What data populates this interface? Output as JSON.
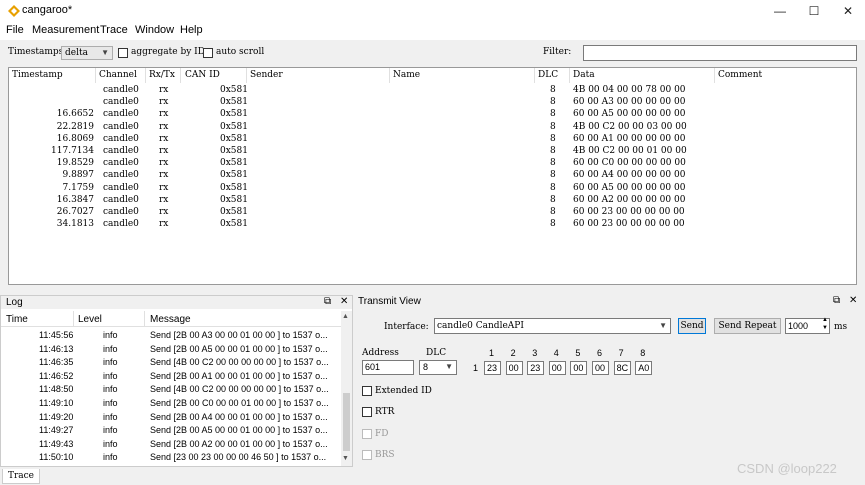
{
  "window": {
    "title": "cangaroo*",
    "minimize": "—",
    "maximize": "☐",
    "close": "✕"
  },
  "menu": [
    "File",
    "Measurement",
    "Trace",
    "Window",
    "Help"
  ],
  "toolbar": {
    "timestamps_label": "Timestamps:",
    "timestamps_value": "delta",
    "aggregate_label": "aggregate by ID",
    "autoscroll_label": "auto scroll",
    "filter_label": "Filter:",
    "filter_value": ""
  },
  "trace": {
    "columns": [
      "Timestamp",
      "Channel",
      "Rx/Tx",
      "CAN ID",
      "Sender",
      "Name",
      "DLC",
      "Data",
      "Comment"
    ],
    "rows": [
      {
        "ts": "",
        "ch": "candle0",
        "dir": "rx",
        "id": "0x581",
        "dlc": "8",
        "data": "4B 00 04 00 00 78 00 00"
      },
      {
        "ts": "",
        "ch": "candle0",
        "dir": "rx",
        "id": "0x581",
        "dlc": "8",
        "data": "60 00 A3 00 00 00 00 00"
      },
      {
        "ts": "16.6652",
        "ch": "candle0",
        "dir": "rx",
        "id": "0x581",
        "dlc": "8",
        "data": "60 00 A5 00 00 00 00 00"
      },
      {
        "ts": "22.2819",
        "ch": "candle0",
        "dir": "rx",
        "id": "0x581",
        "dlc": "8",
        "data": "4B 00 C2 00 00 03 00 00"
      },
      {
        "ts": "16.8069",
        "ch": "candle0",
        "dir": "rx",
        "id": "0x581",
        "dlc": "8",
        "data": "60 00 A1 00 00 00 00 00"
      },
      {
        "ts": "117.7134",
        "ch": "candle0",
        "dir": "rx",
        "id": "0x581",
        "dlc": "8",
        "data": "4B 00 C2 00 00 01 00 00"
      },
      {
        "ts": "19.8529",
        "ch": "candle0",
        "dir": "rx",
        "id": "0x581",
        "dlc": "8",
        "data": "60 00 C0 00 00 00 00 00"
      },
      {
        "ts": "9.8897",
        "ch": "candle0",
        "dir": "rx",
        "id": "0x581",
        "dlc": "8",
        "data": "60 00 A4 00 00 00 00 00"
      },
      {
        "ts": "7.1759",
        "ch": "candle0",
        "dir": "rx",
        "id": "0x581",
        "dlc": "8",
        "data": "60 00 A5 00 00 00 00 00"
      },
      {
        "ts": "16.3847",
        "ch": "candle0",
        "dir": "rx",
        "id": "0x581",
        "dlc": "8",
        "data": "60 00 A2 00 00 00 00 00"
      },
      {
        "ts": "26.7027",
        "ch": "candle0",
        "dir": "rx",
        "id": "0x581",
        "dlc": "8",
        "data": "60 00 23 00 00 00 00 00"
      },
      {
        "ts": "34.1813",
        "ch": "candle0",
        "dir": "rx",
        "id": "0x581",
        "dlc": "8",
        "data": "60 00 23 00 00 00 00 00"
      }
    ]
  },
  "log": {
    "title": "Log",
    "columns": [
      "Time",
      "Level",
      "Message"
    ],
    "rows": [
      {
        "time": "11:45:56",
        "level": "info",
        "msg": "Send [2B 00 A3 00 00 01 00 00 ] to 1537 o..."
      },
      {
        "time": "11:46:13",
        "level": "info",
        "msg": "Send [2B 00 A5 00 00 01 00 00 ] to 1537 o..."
      },
      {
        "time": "11:46:35",
        "level": "info",
        "msg": "Send [4B 00 C2 00 00 00 00 00 ] to 1537 o..."
      },
      {
        "time": "11:46:52",
        "level": "info",
        "msg": "Send [2B 00 A1 00 00 01 00 00 ] to 1537 o..."
      },
      {
        "time": "11:48:50",
        "level": "info",
        "msg": "Send [4B 00 C2 00 00 00 00 00 ] to 1537 o..."
      },
      {
        "time": "11:49:10",
        "level": "info",
        "msg": "Send [2B 00 C0 00 00 01 00 00 ] to 1537 o..."
      },
      {
        "time": "11:49:20",
        "level": "info",
        "msg": "Send [2B 00 A4 00 00 01 00 00 ] to 1537 o..."
      },
      {
        "time": "11:49:27",
        "level": "info",
        "msg": "Send [2B 00 A5 00 00 01 00 00 ] to 1537 o..."
      },
      {
        "time": "11:49:43",
        "level": "info",
        "msg": "Send [2B 00 A2 00 00 01 00 00 ] to 1537 o..."
      },
      {
        "time": "11:50:10",
        "level": "info",
        "msg": "Send [23 00 23 00 00 00 46 50 ] to 1537 o..."
      }
    ]
  },
  "transmit": {
    "title": "Transmit View",
    "interface_label": "Interface:",
    "interface_value": "candle0 CandleAPI",
    "send_label": "Send",
    "send_repeat_label": "Send Repeat",
    "repeat_ms": "1000",
    "ms_label": "ms",
    "address_label": "Address",
    "address_value": "601",
    "dlc_label": "DLC",
    "dlc_value": "8",
    "byte_headers": [
      "1",
      "2",
      "3",
      "4",
      "5",
      "6",
      "7",
      "8"
    ],
    "row_index": "1",
    "bytes": [
      "23",
      "00",
      "23",
      "00",
      "00",
      "00",
      "8C",
      "A0"
    ],
    "extended_id_label": "Extended ID",
    "rtr_label": "RTR",
    "fd_label": "FD",
    "brs_label": "BRS"
  },
  "tabs": [
    "Trace"
  ],
  "watermark": "CSDN @loop222",
  "colors": {
    "accent": "#0078d7",
    "logo": "#e8a000"
  }
}
